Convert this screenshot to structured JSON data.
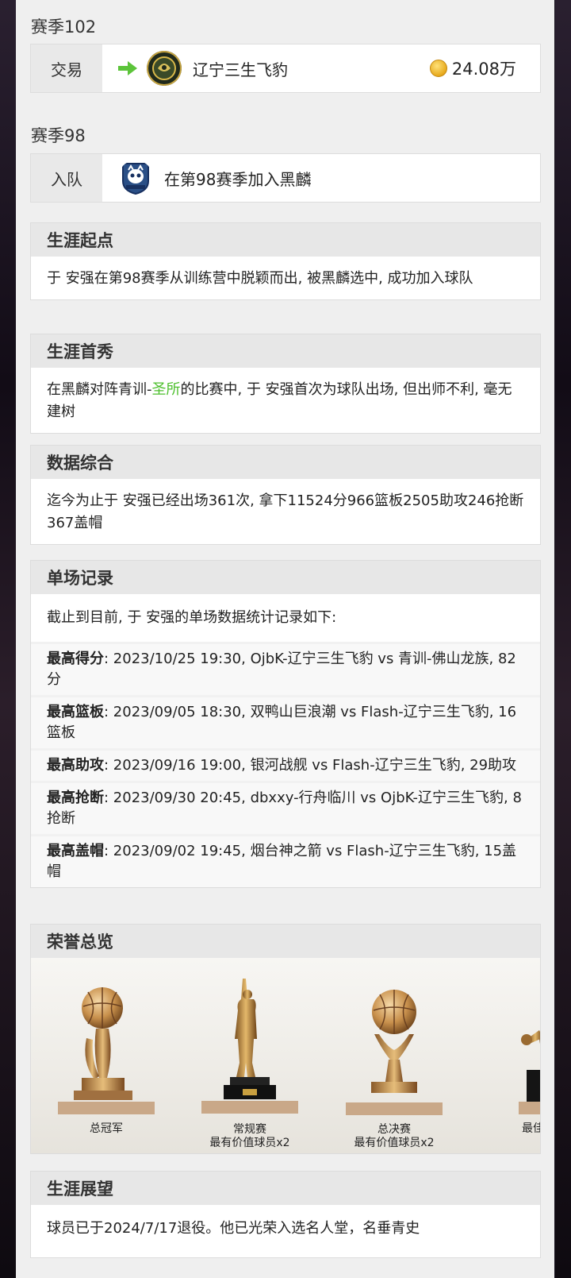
{
  "seasons": [
    {
      "title": "赛季102",
      "event_type": "交易",
      "team": "辽宁三生飞豹",
      "fee": "24.08万"
    },
    {
      "title": "赛季98",
      "event_type": "入队",
      "text": "在第98赛季加入黑麟"
    }
  ],
  "career_start": {
    "header": "生涯起点",
    "body": "于 安强在第98赛季从训练营中脱颖而出, 被黑麟选中, 成功加入球队"
  },
  "career_debut": {
    "header": "生涯首秀",
    "body_before": "在黑麟对阵青训-",
    "highlight": "圣所",
    "body_after": "的比赛中, 于 安强首次为球队出场, 但出师不利, 毫无建树"
  },
  "stats_summary": {
    "header": "数据综合",
    "body": "迄今为止于 安强已经出场361次, 拿下11524分966篮板2505助攻246抢断367盖帽"
  },
  "single_game_records": {
    "header": "单场记录",
    "intro": "截止到目前, 于 安强的单场数据统计记录如下:",
    "records": [
      {
        "label": "最高得分",
        "text": ": 2023/10/25 19:30, OjbK-辽宁三生飞豹 vs 青训-佛山龙族, 82分"
      },
      {
        "label": "最高篮板",
        "text": ": 2023/09/05 18:30, 双鸭山巨浪潮 vs Flash-辽宁三生飞豹, 16篮板"
      },
      {
        "label": "最高助攻",
        "text": ": 2023/09/16 19:00, 银河战舰 vs Flash-辽宁三生飞豹, 29助攻"
      },
      {
        "label": "最高抢断",
        "text": ": 2023/09/30 20:45, dbxxy-行舟临川 vs OjbK-辽宁三生飞豹, 8抢断"
      },
      {
        "label": "最高盖帽",
        "text": ": 2023/09/02 19:45, 烟台神之箭 vs Flash-辽宁三生飞豹, 15盖帽"
      }
    ]
  },
  "honors": {
    "header": "荣誉总览",
    "items": [
      {
        "label": "总冠军",
        "icon": "ball-trophy-icon"
      },
      {
        "label_line1": "常规赛",
        "label_line2": "最有价值球员x2",
        "icon": "player-statue-trophy-icon"
      },
      {
        "label_line1": "总决赛",
        "label_line2": "最有价值球员x2",
        "icon": "ball-trophy-icon"
      },
      {
        "label": "最佳控",
        "icon": "player-statue-trophy-icon"
      }
    ]
  },
  "career_outlook": {
    "header": "生涯展望",
    "body": "球员已于2024/7/17退役。他已光荣入选名人堂，名垂青史"
  },
  "colors": {
    "accent_green": "#4cbf2c",
    "coin_gold": "#e7a91c",
    "panel_bg": "#efefef"
  }
}
